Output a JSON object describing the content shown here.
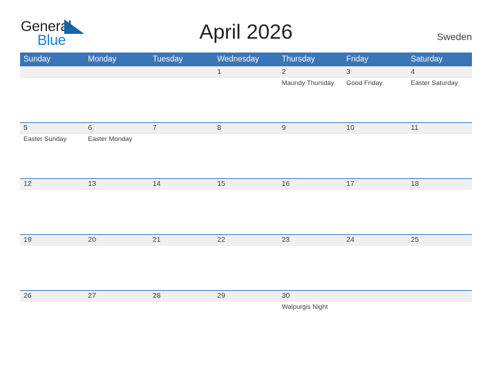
{
  "brand": {
    "line1": "General",
    "line2": "Blue",
    "flag_icon": "blue-triangle-flag-icon",
    "accent_color": "#1a7fd4"
  },
  "header": {
    "title": "April 2026",
    "region": "Sweden"
  },
  "colors": {
    "header_blue": "#3b75b5",
    "band_gray": "#f0f0f0",
    "text": "#3d3d3d",
    "title_text": "#231f20"
  },
  "calendar": {
    "weekdays": [
      "Sunday",
      "Monday",
      "Tuesday",
      "Wednesday",
      "Thursday",
      "Friday",
      "Saturday"
    ],
    "weeks": [
      [
        {
          "day": "",
          "event": ""
        },
        {
          "day": "",
          "event": ""
        },
        {
          "day": "",
          "event": ""
        },
        {
          "day": "1",
          "event": ""
        },
        {
          "day": "2",
          "event": "Maundy Thursday"
        },
        {
          "day": "3",
          "event": "Good Friday"
        },
        {
          "day": "4",
          "event": "Easter Saturday"
        }
      ],
      [
        {
          "day": "5",
          "event": "Easter Sunday"
        },
        {
          "day": "6",
          "event": "Easter Monday"
        },
        {
          "day": "7",
          "event": ""
        },
        {
          "day": "8",
          "event": ""
        },
        {
          "day": "9",
          "event": ""
        },
        {
          "day": "10",
          "event": ""
        },
        {
          "day": "11",
          "event": ""
        }
      ],
      [
        {
          "day": "12",
          "event": ""
        },
        {
          "day": "13",
          "event": ""
        },
        {
          "day": "14",
          "event": ""
        },
        {
          "day": "15",
          "event": ""
        },
        {
          "day": "16",
          "event": ""
        },
        {
          "day": "17",
          "event": ""
        },
        {
          "day": "18",
          "event": ""
        }
      ],
      [
        {
          "day": "19",
          "event": ""
        },
        {
          "day": "20",
          "event": ""
        },
        {
          "day": "21",
          "event": ""
        },
        {
          "day": "22",
          "event": ""
        },
        {
          "day": "23",
          "event": ""
        },
        {
          "day": "24",
          "event": ""
        },
        {
          "day": "25",
          "event": ""
        }
      ],
      [
        {
          "day": "26",
          "event": ""
        },
        {
          "day": "27",
          "event": ""
        },
        {
          "day": "28",
          "event": ""
        },
        {
          "day": "29",
          "event": ""
        },
        {
          "day": "30",
          "event": "Walpurgis Night"
        },
        {
          "day": "",
          "event": ""
        },
        {
          "day": "",
          "event": ""
        }
      ]
    ]
  }
}
